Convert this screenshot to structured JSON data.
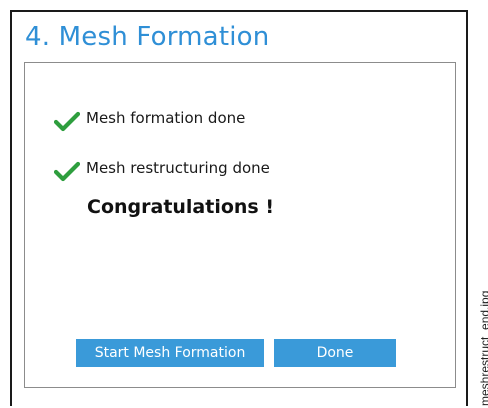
{
  "window": {
    "title": "4. Mesh Formation"
  },
  "status": {
    "items": [
      {
        "label": "Mesh formation done",
        "icon": "checkmark-icon"
      },
      {
        "label": "Mesh restructuring done",
        "icon": "checkmark-icon"
      }
    ],
    "message": "Congratulations !"
  },
  "buttons": {
    "start_label": "Start Mesh Formation",
    "done_label": "Done"
  },
  "caption": "meshrestruct_end.jpg",
  "colors": {
    "title": "#2f8fd6",
    "button": "#3a9ad9",
    "check": "#2e9e3e"
  }
}
